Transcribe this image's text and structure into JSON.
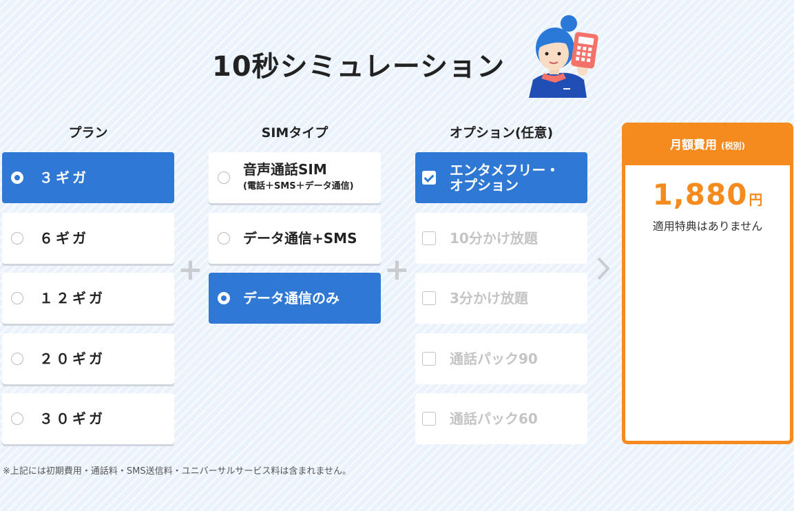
{
  "title": "10秒シミュレーション",
  "columns": {
    "plan": "プラン",
    "sim": "SIMタイプ",
    "option": "オプション(任意)"
  },
  "plans": [
    {
      "label": "３ギガ",
      "selected": true
    },
    {
      "label": "６ギガ",
      "selected": false
    },
    {
      "label": "１２ギガ",
      "selected": false
    },
    {
      "label": "２０ギガ",
      "selected": false
    },
    {
      "label": "３０ギガ",
      "selected": false
    }
  ],
  "sim_types": [
    {
      "label": "音声通話SIM",
      "sub": "(電話＋SMS＋データ通信)",
      "selected": false
    },
    {
      "label": "データ通信+SMS",
      "selected": false
    },
    {
      "label": "データ通信のみ",
      "selected": true
    }
  ],
  "options": [
    {
      "label": "エンタメフリー・",
      "label2": "オプション",
      "checked": true,
      "disabled": false
    },
    {
      "label": "10分かけ放題",
      "checked": false,
      "disabled": true
    },
    {
      "label": "3分かけ放題",
      "checked": false,
      "disabled": true
    },
    {
      "label": "通話パック90",
      "checked": false,
      "disabled": true
    },
    {
      "label": "通話パック60",
      "checked": false,
      "disabled": true
    }
  ],
  "result": {
    "heading": "月額費用",
    "heading_note": "(税別)",
    "price": "1,880",
    "unit": "円",
    "benefit": "適用特典はありません"
  },
  "footnote": "※上記には初期費用・通話料・SMS送信料・ユニバーサルサービス料は含まれません。",
  "colors": {
    "accent_blue": "#2f79d4",
    "accent_orange": "#f58a1f",
    "background": "#eaf3fc"
  },
  "icons": {
    "mascot": "staff-with-calculator-illustration",
    "plus": "plus-icon",
    "arrow": "chevron-right-icon"
  }
}
